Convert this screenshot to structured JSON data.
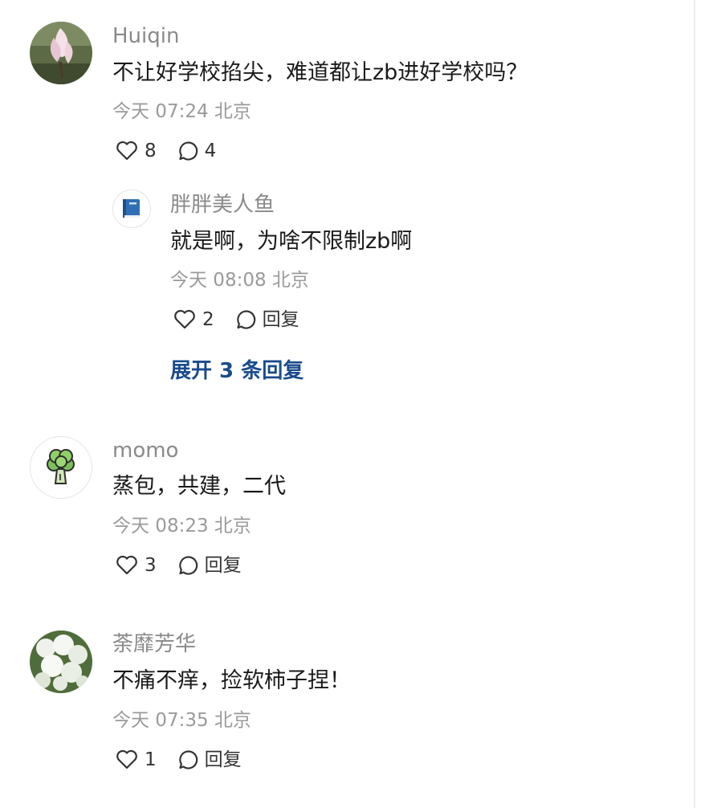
{
  "comments": [
    {
      "name": "Huiqin",
      "text": "不让好学校掐尖，难道都让zb进好学校吗？",
      "time": "今天 07:24 北京",
      "likes": "8",
      "replies_count": "4",
      "avatar_icon": "magnolia-flower-photo",
      "reply": {
        "name": "胖胖美人鱼",
        "text": "就是啊，为啥不限制zb啊",
        "time": "今天 08:08 北京",
        "likes": "2",
        "reply_label": "回复",
        "avatar_icon": "blue-book-icon"
      },
      "expand_label": "展开 3 条回复"
    },
    {
      "name": "momo",
      "text": "蒸包，共建，二代",
      "time": "今天 08:23 北京",
      "likes": "3",
      "reply_label": "回复",
      "avatar_icon": "broccoli-icon"
    },
    {
      "name": "荼靡芳华",
      "text": "不痛不痒，捡软柿子捏！",
      "time": "今天 07:35 北京",
      "likes": "1",
      "reply_label": "回复",
      "avatar_icon": "white-flowers-photo"
    }
  ],
  "colors": {
    "link": "#1a4b8c",
    "name": "#8a8a8a",
    "text": "#1a1a1a",
    "meta": "#9a9a9a",
    "icon": "#333333"
  }
}
